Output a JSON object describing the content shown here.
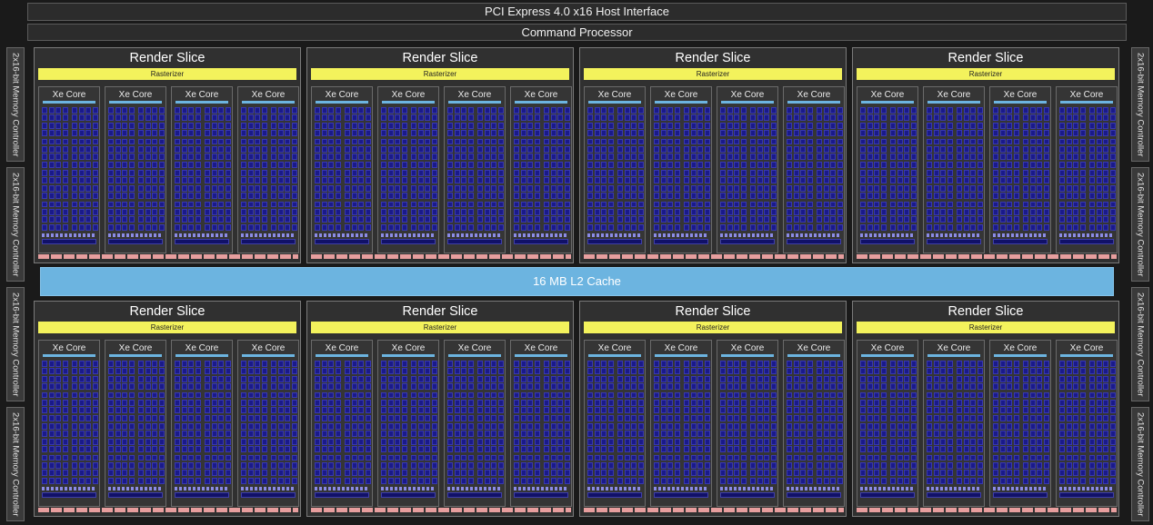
{
  "host_interface": "PCI Express 4.0 x16 Host Interface",
  "command_processor": "Command Processor",
  "l2_cache": "16 MB L2 Cache",
  "memory_controller_label": "2x16-bit Memory Controller",
  "memory_controllers": {
    "left": [
      "2x16-bit Memory Controller",
      "2x16-bit Memory Controller",
      "2x16-bit Memory Controller",
      "2x16-bit Memory Controller"
    ],
    "right": [
      "2x16-bit Memory Controller",
      "2x16-bit Memory Controller",
      "2x16-bit Memory Controller",
      "2x16-bit Memory Controller"
    ]
  },
  "render_slice": {
    "title": "Render Slice",
    "rasterizer": "Rasterizer",
    "xe_core": "Xe Core"
  },
  "layout": {
    "slice_rows": 2,
    "slices_per_row": 4,
    "xe_cores_per_slice": 4
  },
  "colors": {
    "background": "#1a1a1a",
    "l2_cache": "#6cb4e0",
    "rasterizer": "#f3f25c",
    "execution_unit": "#1a1a8a",
    "slice_bottom_bar": "#e79e9e"
  }
}
